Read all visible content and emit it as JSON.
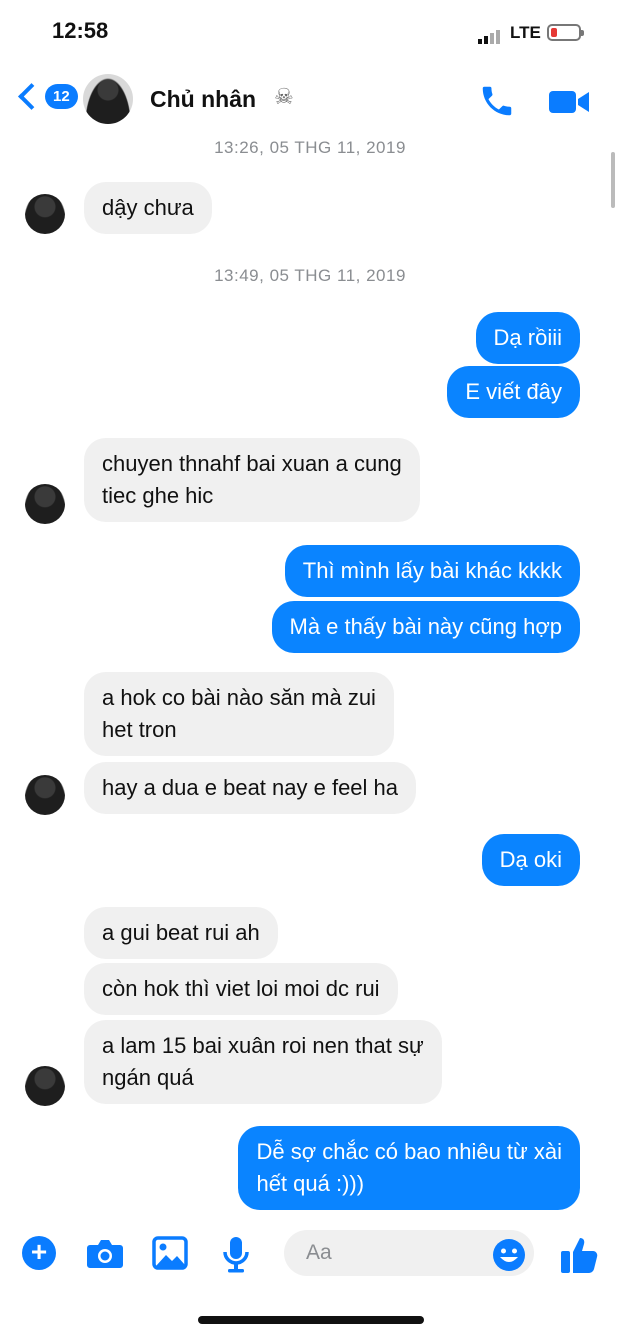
{
  "status": {
    "time": "12:58",
    "network": "LTE"
  },
  "header": {
    "unread_count": "12",
    "contact_name": "Chủ nhân",
    "name_emoji": "☠"
  },
  "colors": {
    "accent": "#0a7cff",
    "outgoing_bubble": "#0a84ff",
    "incoming_bubble": "#f0f0f0",
    "battery_low": "#e53935"
  },
  "thread": {
    "timestamps": [
      "13:26, 05 THG 11, 2019",
      "13:49, 05 THG 11, 2019"
    ],
    "messages": [
      {
        "dir": "in",
        "lines": [
          "dậy chưa"
        ]
      },
      {
        "dir": "out",
        "lines": [
          "Dạ rồiii"
        ]
      },
      {
        "dir": "out",
        "lines": [
          "E viết đây"
        ]
      },
      {
        "dir": "in",
        "lines": [
          "chuyen thnahf bai xuan a cung",
          "tiec ghe hic"
        ]
      },
      {
        "dir": "out",
        "lines": [
          "Thì mình lấy bài khác kkkk"
        ]
      },
      {
        "dir": "out",
        "lines": [
          "Mà e thấy bài này cũng hợp"
        ]
      },
      {
        "dir": "in",
        "lines": [
          "a hok co bài nào săn mà zui",
          "het tron"
        ]
      },
      {
        "dir": "in",
        "lines": [
          "hay a dua e beat nay e feel ha"
        ]
      },
      {
        "dir": "out",
        "lines": [
          "Dạ oki"
        ]
      },
      {
        "dir": "in",
        "lines": [
          "a gui beat rui ah"
        ]
      },
      {
        "dir": "in",
        "lines": [
          "còn hok thì viet loi moi dc rui"
        ]
      },
      {
        "dir": "in",
        "lines": [
          "a lam 15 bai xuân roi nen that sự",
          "ngán quá"
        ]
      },
      {
        "dir": "out",
        "lines": [
          "Dễ sợ chắc có bao nhiêu từ xài",
          "hết quá :)))"
        ]
      }
    ]
  },
  "composer": {
    "placeholder": "Aa"
  },
  "icons": {
    "back": "chevron-left-icon",
    "call": "phone-icon",
    "video": "video-camera-icon",
    "plus": "plus-icon",
    "camera": "camera-icon",
    "gallery": "image-icon",
    "mic": "microphone-icon",
    "emoji": "smiley-icon",
    "like": "thumbs-up-icon"
  }
}
